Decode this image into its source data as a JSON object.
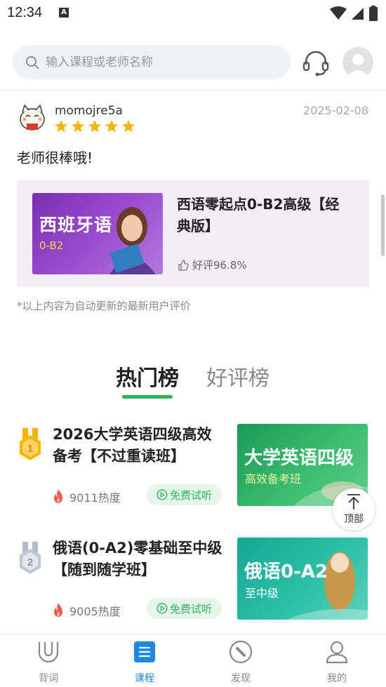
{
  "status_bar": {
    "time": "12:34",
    "notif_badge": "A"
  },
  "search": {
    "placeholder": "输入课程或老师名称"
  },
  "icons": {
    "headset": "headset-icon",
    "profile": "avatar",
    "search": "search-icon"
  },
  "review": {
    "username": "momojre5a",
    "date": "2025-02-08",
    "stars": 5,
    "text": "老师很棒哦!",
    "avatar_caption": "招财猫"
  },
  "reviewed_course": {
    "thumb_title": "西班牙语",
    "thumb_sub": "0-B2",
    "title": "西语零起点0-B2高级【经典版】",
    "rating": "好评96.8%"
  },
  "auto_note": "*以上内容为自动更新的最新用户评价",
  "tabs": {
    "hot": "热门榜",
    "good": "好评榜"
  },
  "rank_list": [
    {
      "rank": "1",
      "title": "2026大学英语四级高效备考【不过重读班】",
      "heat": "9011热度",
      "trial": "免费试听",
      "thumb_title": "大学英语四级",
      "thumb_sub": "高效备考班"
    },
    {
      "rank": "2",
      "title": "俄语(0-A2)零基础至中级【随到随学班】",
      "heat": "9005热度",
      "trial": "免费试听",
      "thumb_title": "俄语0-A2",
      "thumb_sub": "至中级"
    }
  ],
  "top_button": {
    "label": "顶部"
  },
  "bottom_nav": [
    {
      "label": "背词",
      "active": false
    },
    {
      "label": "课程",
      "active": true
    },
    {
      "label": "发现",
      "active": false
    },
    {
      "label": "我的",
      "active": false
    }
  ],
  "colors": {
    "accent_green": "#2bb35a",
    "active_blue": "#1e88e5",
    "star_yellow": "#f7b500"
  }
}
